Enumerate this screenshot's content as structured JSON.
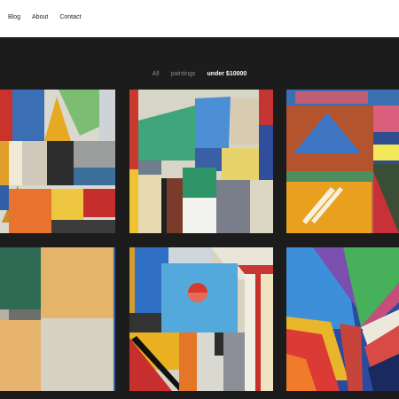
{
  "nav": {
    "items": [
      {
        "label": "Blog"
      },
      {
        "label": "About"
      },
      {
        "label": "Contact"
      }
    ]
  },
  "filters": {
    "items": [
      {
        "label": "All"
      },
      {
        "label": "paintings"
      },
      {
        "label": "under $10000"
      }
    ],
    "active": "under $10000"
  },
  "colors": {
    "topbar": "#ffffff",
    "background": "#1c1c1c",
    "filter_inactive": "#8a8a8a",
    "filter_active": "#ffffff"
  }
}
